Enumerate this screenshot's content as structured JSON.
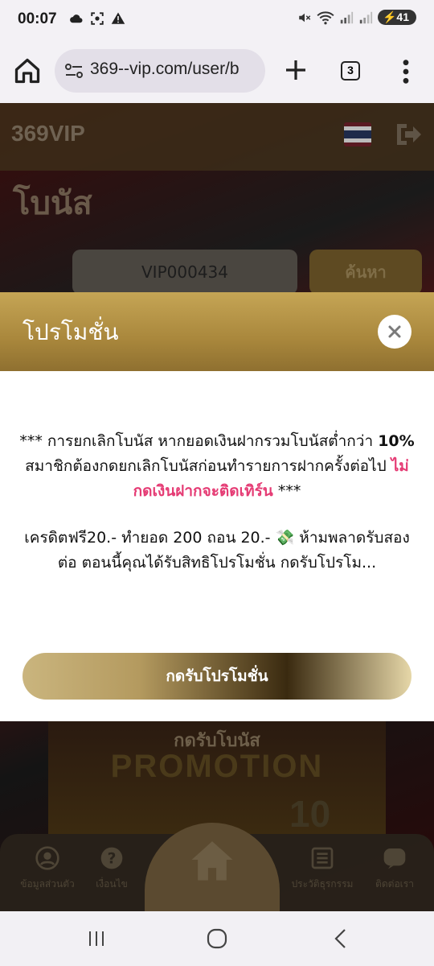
{
  "status": {
    "time": "00:07",
    "battery": "41"
  },
  "browser": {
    "url": "369--vip.com/user/b",
    "tab_count": "3"
  },
  "site": {
    "logo": "369VIP",
    "page_title": "โบนัส",
    "search_value": "VIP000434",
    "search_button": "ค้นหา"
  },
  "modal": {
    "title": "โปรโมชั่น",
    "para1_a": "*** การยกเลิกโบนัส หากยอดเงินฝากรวมโบนัสต่ำกว่า ",
    "para1_bold": "10%",
    "para1_b": " สมาชิกต้องกดยกเลิกโบนัสก่อนทำรายการฝากครั้งต่อไป ",
    "para1_highlight": "ไม่กดเงินฝากจะติดเทิร์น",
    "para1_c": " ***",
    "para2_a": "เครดิตฟรี20.- ทำยอด 200 ถอน 20.- ",
    "para2_emoji": "💸",
    "para2_b": " ห้ามพลาดรับสองต่อ ตอนนี้คุณได้รับสิทธิโปรโมชั่น  กดรับโปรโม...",
    "claim_button": "กดรับโปรโมชั่น"
  },
  "banner": {
    "subtitle": "กดรับโบนัส",
    "title": "PROMOTION",
    "number": "10"
  },
  "bottom_nav": [
    {
      "label": "ข้อมูลส่วนตัว"
    },
    {
      "label": "เงื่อนไข"
    },
    {
      "label": "ประวัติธุรกรรม"
    },
    {
      "label": "ติดต่อเรา"
    }
  ],
  "colors": {
    "modal_header": "#b08f43",
    "highlight": "#e53b74"
  },
  "icons": [
    "home-icon",
    "site-settings-icon",
    "plus-icon",
    "tabs-icon",
    "more-vert-icon",
    "close-icon",
    "logout-icon",
    "thai-flag-icon",
    "user-icon",
    "question-icon",
    "list-icon",
    "line-chat-icon"
  ]
}
